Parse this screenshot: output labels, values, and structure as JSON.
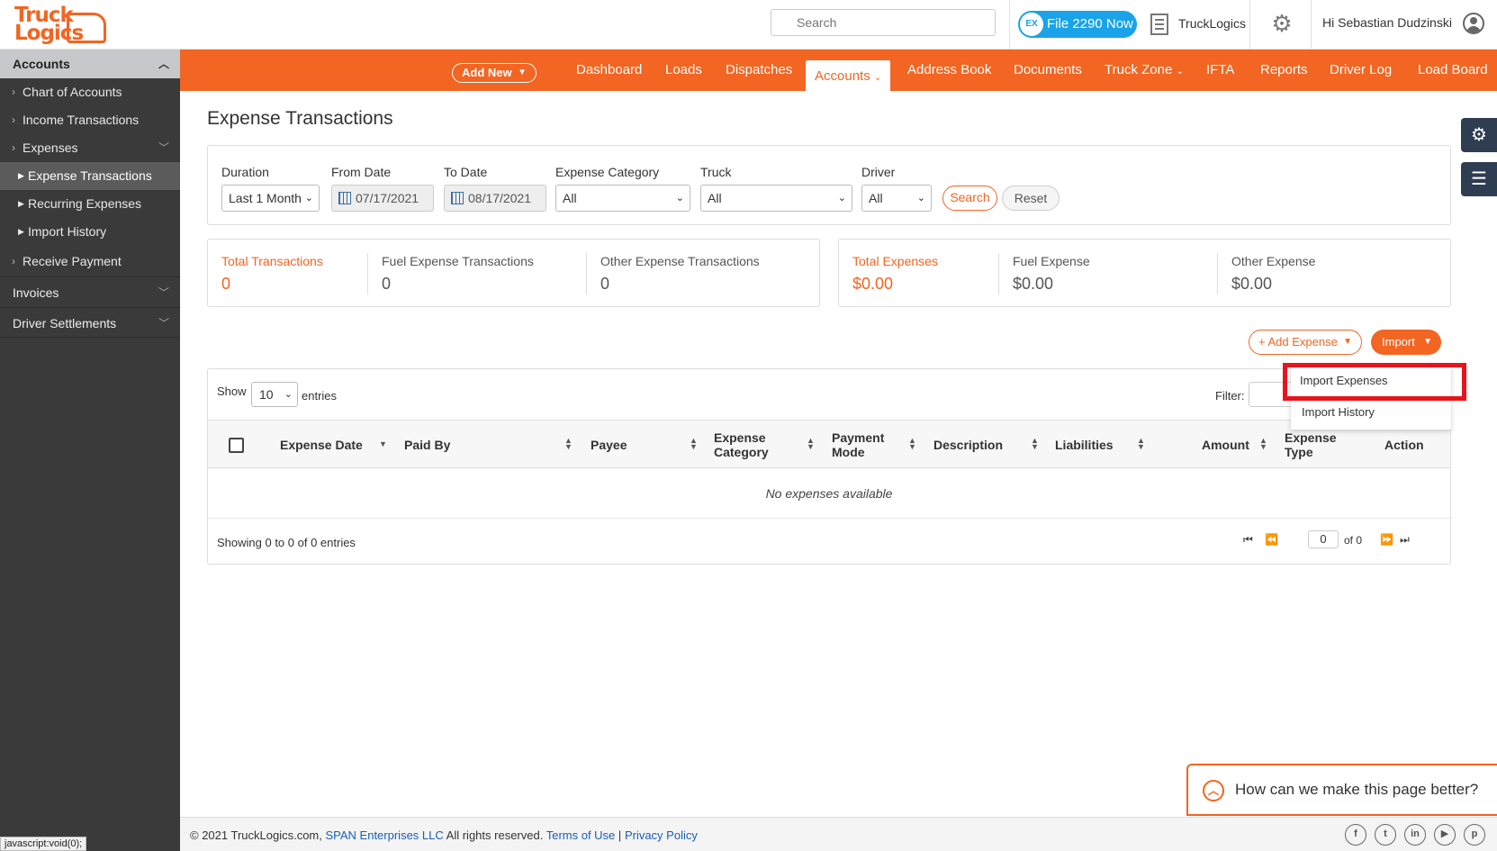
{
  "brand": {
    "logo_line1": "Truck",
    "logo_line2": "Logics",
    "color": "#f26522"
  },
  "header": {
    "search_placeholder": "Search",
    "file2290_badge": "EX",
    "file2290_label": "File 2290 Now",
    "company_name": "TruckLogics",
    "greeting": "Hi Sebastian Dudzinski"
  },
  "sidebar": {
    "head": "Accounts",
    "items": [
      {
        "label": "Chart of Accounts"
      },
      {
        "label": "Income Transactions"
      },
      {
        "label": "Expenses"
      }
    ],
    "expenses_sub": [
      {
        "label": "Expense Transactions"
      },
      {
        "label": "Recurring Expenses"
      },
      {
        "label": "Import History"
      }
    ],
    "receive_payment": "Receive Payment",
    "invoices": "Invoices",
    "driver_settlements": "Driver Settlements",
    "status_tip": "javascript:void(0);"
  },
  "nav": {
    "add_new": "Add New",
    "items": [
      "Dashboard",
      "Loads",
      "Dispatches",
      "Accounts",
      "Address Book",
      "Documents",
      "Truck Zone",
      "IFTA",
      "Reports",
      "Driver Log",
      "Load Board"
    ]
  },
  "page": {
    "title": "Expense Transactions"
  },
  "filters": {
    "duration_label": "Duration",
    "duration_value": "Last 1 Month",
    "from_label": "From Date",
    "from_value": "07/17/2021",
    "to_label": "To Date",
    "to_value": "08/17/2021",
    "category_label": "Expense Category",
    "category_value": "All",
    "truck_label": "Truck",
    "truck_value": "All",
    "driver_label": "Driver",
    "driver_value": "All",
    "search_btn": "Search",
    "reset_btn": "Reset"
  },
  "stats_left": [
    {
      "label": "Total Transactions",
      "value": "0"
    },
    {
      "label": "Fuel Expense Transactions",
      "value": "0"
    },
    {
      "label": "Other Expense Transactions",
      "value": "0"
    }
  ],
  "stats_right": [
    {
      "label": "Total Expenses",
      "value": "$0.00"
    },
    {
      "label": "Fuel Expense",
      "value": "$0.00"
    },
    {
      "label": "Other Expense",
      "value": "$0.00"
    }
  ],
  "actions": {
    "add_expense": "Add Expense",
    "import": "Import",
    "import_menu": [
      "Import Expenses",
      "Import History"
    ]
  },
  "table": {
    "show_label": "Show",
    "page_size": "10",
    "entries_label": "entries",
    "filter_label": "Filter:",
    "columns": [
      "Expense Date",
      "Paid By",
      "Payee",
      "Expense Category",
      "Payment Mode",
      "Description",
      "Liabilities",
      "Amount",
      "Expense Type",
      "Action"
    ],
    "empty_message": "No expenses available",
    "showing": "Showing 0 to 0 of 0 entries",
    "current_page": "0",
    "of_pages": "of 0"
  },
  "feedback": "How can we make this page better?",
  "footer": {
    "copyright": "© 2021 TruckLogics.com,",
    "span": "SPAN Enterprises LLC",
    "rights": "All rights reserved.",
    "terms": "Terms of Use",
    "sep": "|",
    "privacy": "Privacy Policy"
  },
  "social_icons": [
    "facebook-icon",
    "twitter-icon",
    "linkedin-icon",
    "youtube-icon",
    "pinterest-icon"
  ]
}
